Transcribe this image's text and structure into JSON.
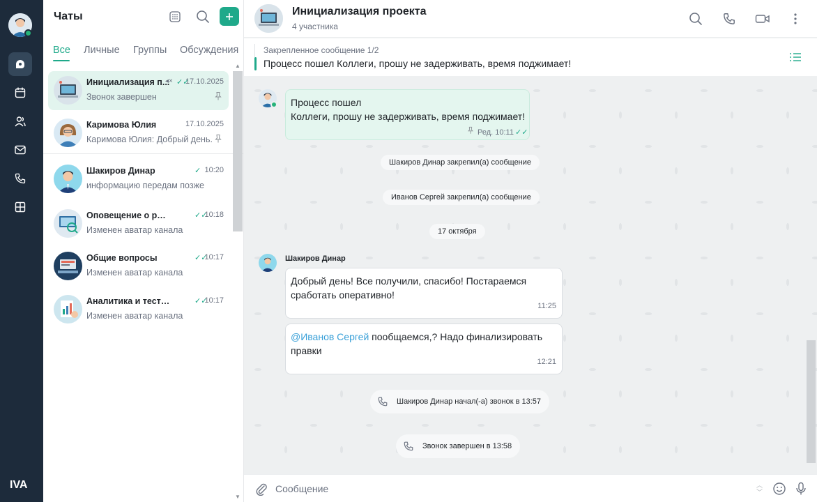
{
  "colors": {
    "accent": "#1fa98a",
    "rail": "#1d2b3b",
    "online": "#26b37a",
    "mention": "#3aa0d8"
  },
  "rail": {
    "items": [
      "chats-icon",
      "calendar-icon",
      "contacts-icon",
      "mail-icon",
      "phone-icon",
      "apps-icon"
    ],
    "logo": "IVA"
  },
  "list": {
    "title": "Чаты",
    "tabs": [
      "Все",
      "Личные",
      "Группы",
      "Обсуждения"
    ],
    "items": [
      {
        "name": "Инициализация п...",
        "time": "17.10.2025",
        "preview": "Звонок завершен",
        "muted": "◂×",
        "ticks": "✓✓"
      },
      {
        "name": "Каримова Юлия",
        "time": "17.10.2025",
        "preview": "Каримова Юлия: Добрый день."
      },
      {
        "name": "Шакиров Динар",
        "time": "10:20",
        "preview": "информацию передам позже",
        "ticks": "✓"
      },
      {
        "name": "Оповещение о релизах",
        "time": "10:18",
        "preview": "Изменен аватар канала",
        "ticks": "✓✓"
      },
      {
        "name": "Общие вопросы",
        "time": "10:17",
        "preview": "Изменен аватар канала",
        "ticks": "✓✓"
      },
      {
        "name": "Аналитика и тестирован...",
        "time": "10:17",
        "preview": "Изменен аватар канала",
        "ticks": "✓✓"
      }
    ]
  },
  "chat": {
    "title": "Инициализация проекта",
    "subtitle": "4 участника",
    "pinned": {
      "label": "Закрепленное сообщение 1/2",
      "text": "Процесс пошел Коллеги, прошу не задерживать, время поджимает!"
    },
    "messages": {
      "own1_line1": "Процесс пошел",
      "own1_line2": "Коллеги, прошу не задерживать,  время поджимает!",
      "own1_meta": "Ред. 10:11",
      "sys1": "Шакиров Динар закрепил(а) сообщение",
      "sys2": "Иванов Сергей закрепил(а) сообщение",
      "date": "17 октября",
      "sender": "Шакиров Динар",
      "in1_text": "Добрый день! Все получили, спасибо! Постараемся сработать оперативно!",
      "in1_time": "11:25",
      "in2_mention": "@Иванов Сергей",
      "in2_text": " пообщаемся,? Надо финализировать правки",
      "in2_time": "12:21",
      "call1": "Шакиров Динар начал(-а) звонок в 13:57",
      "call2": "Звонок завершен в 13:58"
    },
    "composer_placeholder": "Сообщение"
  }
}
